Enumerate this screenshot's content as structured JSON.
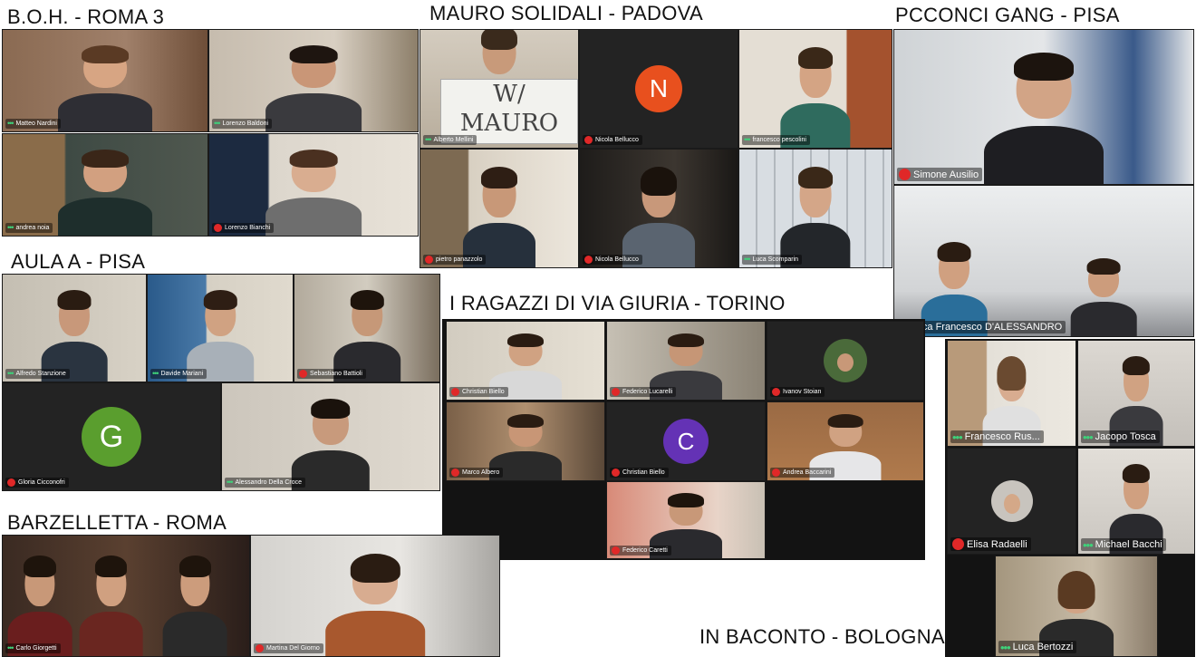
{
  "groups": {
    "boh": "B.O.H. - ROMA 3",
    "mauro": "MAURO SOLIDALI - PADOVA",
    "pcconci": "PCCONCI GANG - PISA",
    "aula": "AULA A - PISA",
    "giuria": "I RAGAZZI DI VIA GIURIA - TORINO",
    "barzelletta": "BARZELLETTA - ROMA",
    "baconto": "IN BACONTO - BOLOGNA"
  },
  "participants": {
    "p1": "Matteo Nardini",
    "p2": "Lorenzo Baldoni",
    "p3": "andrea noia",
    "p4": "Lorenzo Bianchi",
    "p5": "Alberto Mellini",
    "p6": "Nicola Bellucco",
    "p7": "francesco pescolini",
    "p8": "pietro panazzolo",
    "p9": "Nicola Bellucco",
    "p10": "Luca Scomparin",
    "p11": "Simone Ausilio",
    "p12": "Luca Francesco D'ALESSANDRO",
    "p13": "Alfredo Stanzione",
    "p14": "Davide Mariani",
    "p15": "Sebastiano Battioli",
    "p16": "Gloria Cicconofri",
    "p17": "Alessandro Della Croce",
    "p18": "Christian Biello",
    "p19": "Federico Lucarelli",
    "p20": "Ivanov Stoian",
    "p21": "Marco Albero",
    "p22": "Christian Biello",
    "p23": "Andrea Baccarini",
    "p24": "Federico Caretti",
    "p25": "Francesco Rus...",
    "p26": "Jacopo Tosca",
    "p27": "Elisa Radaelli",
    "p28": "Michael Bacchi",
    "p29": "Luca Bertozzi",
    "p30": "Carlo Giorgetti",
    "p31": "Martina Del Giorno"
  },
  "avatars": {
    "n": "N",
    "g": "G",
    "c": "C"
  },
  "sign_text": "W/ MAURO",
  "colors": {
    "mic_muted": "#e02828",
    "avatar_n": "#e8501e",
    "avatar_g": "#5a9e2e",
    "avatar_c": "#6432b5"
  }
}
